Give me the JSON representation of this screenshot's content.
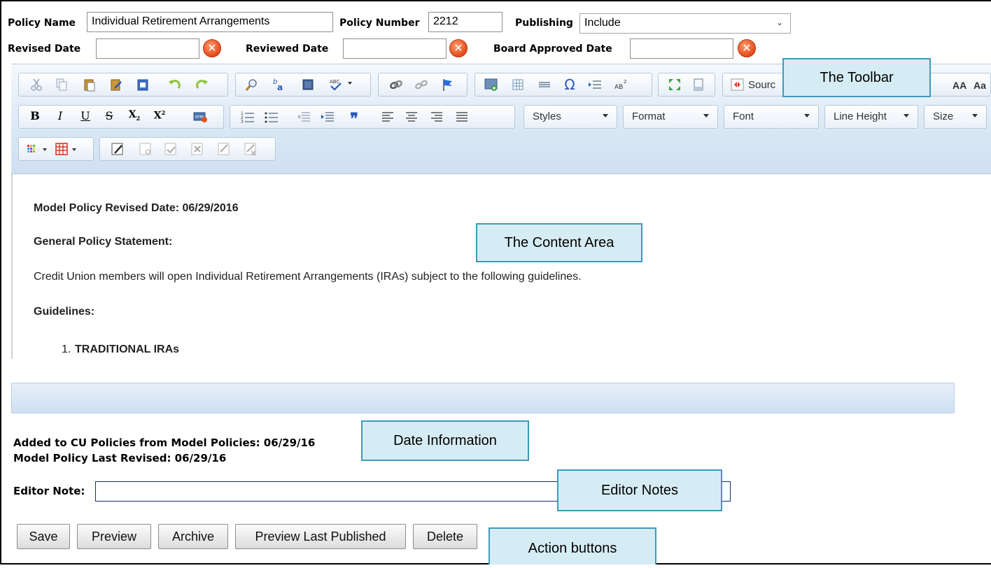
{
  "form": {
    "policy_name_label": "Policy Name",
    "policy_name_value": "Individual Retirement Arrangements",
    "policy_number_label": "Policy Number",
    "policy_number_value": "2212",
    "publishing_label": "Publishing",
    "publishing_value": "Include",
    "revised_date_label": "Revised Date",
    "reviewed_date_label": "Reviewed Date",
    "board_approved_label": "Board Approved Date",
    "clear_glyph": "✕"
  },
  "toolbar": {
    "source_label": "Sourc",
    "aa_label": "AA",
    "aa2_label": "Aa",
    "styles_label": "Styles",
    "format_label": "Format",
    "font_label": "Font",
    "line_height_label": "Line Height",
    "size_label": "Size"
  },
  "content": {
    "revised_line": "Model Policy Revised Date: 06/29/2016",
    "heading_general": "General Policy Statement:",
    "paragraph": "Credit Union members will open Individual Retirement Arrangements (IRAs) subject to the following guidelines.",
    "heading_guidelines": "Guidelines:",
    "list_item_1_num": "1.",
    "list_item_1": "TRADITIONAL IRAs"
  },
  "dates": {
    "added": "Added to CU Policies from Model Policies: 06/29/16",
    "last_revised": "Model Policy Last Revised: 06/29/16"
  },
  "editor_note": {
    "label": "Editor Note:",
    "value": ""
  },
  "buttons": {
    "save": "Save",
    "preview": "Preview",
    "archive": "Archive",
    "preview_last_published": "Preview Last Published",
    "delete": "Delete"
  },
  "callouts": {
    "toolbar": "The Toolbar",
    "content_area": "The Content Area",
    "date_information": "Date Information",
    "editor_notes": "Editor Notes",
    "action_buttons": "Action buttons"
  },
  "icons": {
    "toolbar": [
      "cut-icon",
      "copy-icon",
      "paste-icon",
      "paste-text-icon",
      "paste-word-icon",
      "undo-icon",
      "redo-icon",
      "find-icon",
      "replace-icon",
      "select-all-icon",
      "spellcheck-icon",
      "link-icon",
      "unlink-icon",
      "anchor-icon",
      "image-icon",
      "table-icon",
      "horizontal-rule-icon",
      "special-char-icon",
      "page-break-icon",
      "superscript-style-icon",
      "maximize-icon",
      "show-blocks-icon",
      "source-icon",
      "bold-icon",
      "italic-icon",
      "underline-icon",
      "strike-icon",
      "subscript-icon",
      "superscript-icon",
      "html-icon",
      "numbered-list-icon",
      "bulleted-list-icon",
      "outdent-icon",
      "indent-icon",
      "blockquote-icon",
      "align-left-icon",
      "align-center-icon",
      "align-right-icon",
      "justify-icon",
      "text-color-icon",
      "table-grid-icon",
      "track-changes-icon"
    ]
  },
  "colors": {
    "toolbar_bg": "#dae7f4",
    "callout_bg": "#d6ecf4",
    "callout_border": "#3e9ab9",
    "clear_button": "#e8501f"
  }
}
